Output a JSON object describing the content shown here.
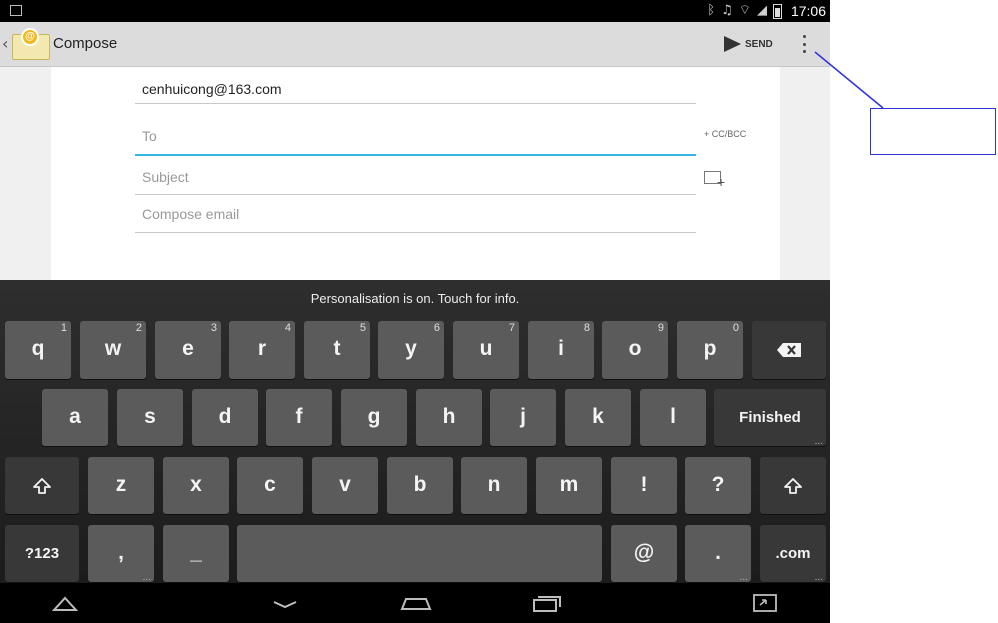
{
  "status_bar": {
    "time": "17:06",
    "icons": [
      "notification-icon",
      "bluetooth-icon",
      "no-sound-icon",
      "wifi-icon",
      "signal-icon",
      "battery-icon"
    ]
  },
  "action_bar": {
    "title": "Compose",
    "send_label": "SEND",
    "icons": [
      "up-arrow-icon",
      "email-app-icon",
      "send-icon",
      "overflow-menu-icon"
    ]
  },
  "compose": {
    "from": "cenhuicong@163.com",
    "to_placeholder": "To",
    "cc_bcc_label": "+ CC/BCC",
    "subject_placeholder": "Subject",
    "body_placeholder": "Compose email",
    "accent_color": "#33b5e5"
  },
  "keyboard": {
    "suggestion_text": "Personalisation is on. Touch for info.",
    "row1": [
      {
        "label": "q",
        "hint": "1"
      },
      {
        "label": "w",
        "hint": "2"
      },
      {
        "label": "e",
        "hint": "3"
      },
      {
        "label": "r",
        "hint": "4"
      },
      {
        "label": "t",
        "hint": "5"
      },
      {
        "label": "y",
        "hint": "6"
      },
      {
        "label": "u",
        "hint": "7"
      },
      {
        "label": "i",
        "hint": "8"
      },
      {
        "label": "o",
        "hint": "9"
      },
      {
        "label": "p",
        "hint": "0"
      }
    ],
    "row2": [
      "a",
      "s",
      "d",
      "f",
      "g",
      "h",
      "j",
      "k",
      "l"
    ],
    "finished_label": "Finished",
    "row3": [
      "z",
      "x",
      "c",
      "v",
      "b",
      "n",
      "m",
      "!",
      "?"
    ],
    "symbols_label": "?123",
    "comma_label": ",",
    "underscore_label": "_",
    "at_label": "@",
    "period_label": ".",
    "dotcom_label": ".com"
  },
  "nav_bar": {
    "icons": [
      "back-icon",
      "hide-keyboard-icon",
      "home-icon",
      "recent-apps-icon",
      "screen-compat-icon"
    ]
  },
  "annotation": {
    "color": "#2b33d9"
  }
}
